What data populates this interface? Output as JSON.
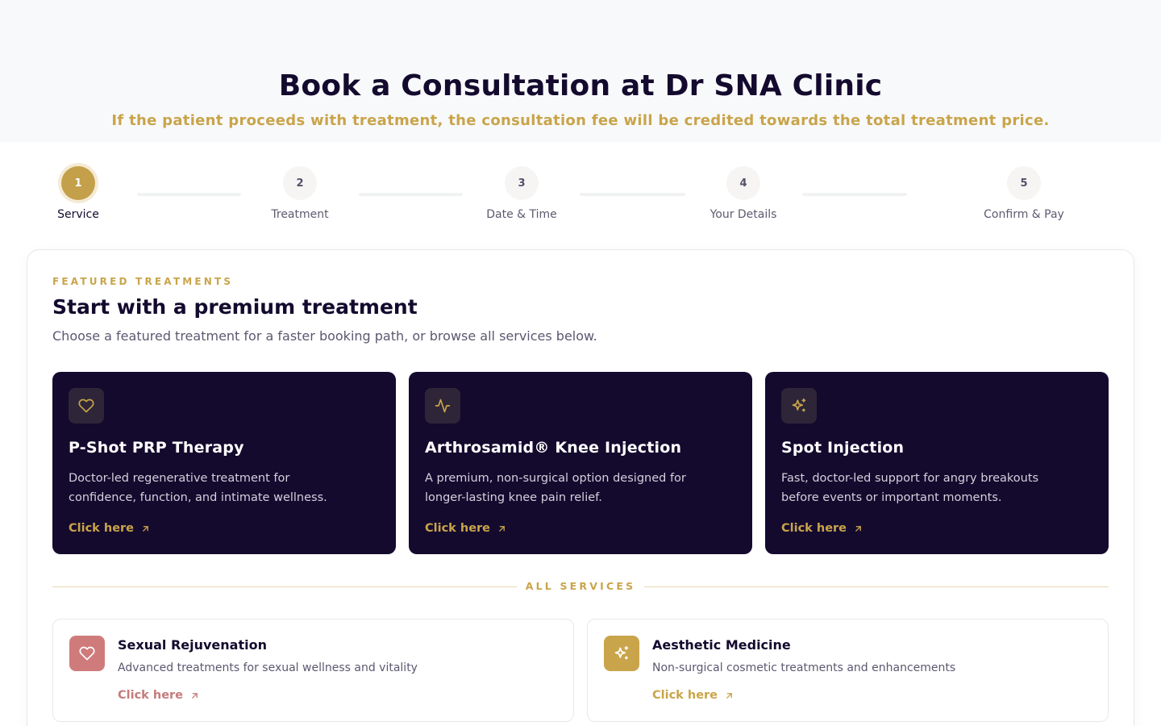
{
  "header": {
    "title": "Book a Consultation at Dr SNA Clinic",
    "subtitle": "If the patient proceeds with treatment, the consultation fee will be credited towards the total treatment price."
  },
  "stepper": {
    "steps": [
      {
        "number": "1",
        "label": "Service",
        "active": true
      },
      {
        "number": "2",
        "label": "Treatment",
        "active": false
      },
      {
        "number": "3",
        "label": "Date & Time",
        "active": false
      },
      {
        "number": "4",
        "label": "Your Details",
        "active": false
      },
      {
        "number": "5",
        "label": "Confirm & Pay",
        "active": false
      }
    ]
  },
  "featured": {
    "eyebrow": "FEATURED TREATMENTS",
    "title": "Start with a premium treatment",
    "subtitle": "Choose a featured treatment for a faster booking path, or browse all services below.",
    "cards": [
      {
        "icon": "heart-icon",
        "title": "P-Shot PRP Therapy",
        "description": "Doctor-led regenerative treatment for confidence, function, and intimate wellness.",
        "link": "Click here"
      },
      {
        "icon": "activity-icon",
        "title": "Arthrosamid® Knee Injection",
        "description": "A premium, non-surgical option designed for longer-lasting knee pain relief.",
        "link": "Click here"
      },
      {
        "icon": "sparkles-icon",
        "title": "Spot Injection",
        "description": "Fast, doctor-led support for angry breakouts before events or important moments.",
        "link": "Click here"
      }
    ]
  },
  "all_services": {
    "label": "ALL SERVICES",
    "cards": [
      {
        "icon": "heart-icon",
        "title": "Sexual Rejuvenation",
        "description": "Advanced treatments for sexual wellness and vitality",
        "link": "Click here",
        "accent": "#d07b7b"
      },
      {
        "icon": "sparkles-icon",
        "title": "Aesthetic Medicine",
        "description": "Non-surgical cosmetic treatments and enhancements",
        "link": "Click here",
        "accent": "#c9a44a"
      }
    ]
  },
  "colors": {
    "navy": "#140a2e",
    "gold": "#c9a44a",
    "rose": "#d07b7b"
  }
}
